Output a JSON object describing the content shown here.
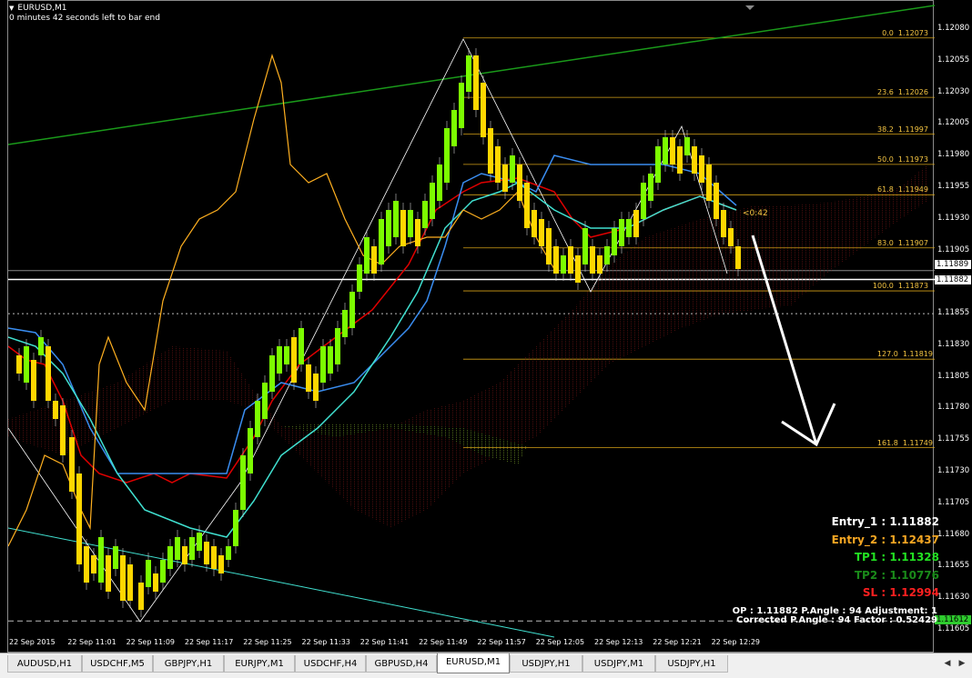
{
  "symbol": {
    "title": "EURUSD,M1",
    "countdown": "0 minutes 42 seconds left to bar end"
  },
  "price_axis": {
    "labels": [
      "1.12080",
      "1.12055",
      "1.12030",
      "1.12005",
      "1.11980",
      "1.11955",
      "1.11930",
      "1.11905",
      "1.11855",
      "1.11830",
      "1.11805",
      "1.11780",
      "1.11755",
      "1.11730",
      "1.11705",
      "1.11680",
      "1.11655",
      "1.11630",
      "1.11605"
    ],
    "bid_label": "1.11889",
    "ask_label": "1.11882",
    "level_label": "1.11612"
  },
  "time_axis": [
    "22 Sep 2015",
    "22 Sep 11:01",
    "22 Sep 11:09",
    "22 Sep 11:17",
    "22 Sep 11:25",
    "22 Sep 11:33",
    "22 Sep 11:41",
    "22 Sep 11:49",
    "22 Sep 11:57",
    "22 Sep 12:05",
    "22 Sep 12:13",
    "22 Sep 12:21",
    "22 Sep 12:29"
  ],
  "fibonacci": [
    {
      "level": "0.0",
      "price": "1.12073"
    },
    {
      "level": "23.6",
      "price": "1.12026"
    },
    {
      "level": "38.2",
      "price": "1.11997"
    },
    {
      "level": "50.0",
      "price": "1.11973"
    },
    {
      "level": "61.8",
      "price": "1.11949"
    },
    {
      "level": "83.0",
      "price": "1.11907"
    },
    {
      "level": "100.0",
      "price": "1.11873"
    },
    {
      "level": "127.0",
      "price": "1.11819"
    },
    {
      "level": "161.8",
      "price": "1.11749"
    }
  ],
  "bar_timer": "<0:42",
  "signals": {
    "entry1": "Entry_1 : 1.11882",
    "entry2": "Entry_2 : 1.12437",
    "tp1": "TP1 : 1.11328",
    "tp2": "TP2 : 1.10776",
    "sl": "SL : 1.12994"
  },
  "footer": {
    "line1": "OP : 1.11882   P.Angle : 94   Adjustment: 1",
    "line2": "Corrected P.Angle : 94   Factor : 0.52429"
  },
  "tabs": [
    "AUDUSD,H1",
    "USDCHF,M5",
    "GBPJPY,H1",
    "EURJPY,M1",
    "USDCHF,H4",
    "GBPUSD,H4",
    "EURUSD,M1",
    "USDJPY,H1",
    "USDJPY,M1",
    "USDJPY,H1"
  ],
  "active_tab": "EURUSD,M1",
  "colors": {
    "bull": "#7cfc00",
    "bear": "#ffd700",
    "red_line": "#e00000",
    "blue_line": "#3a8df0",
    "cyan_line": "#40e0d0",
    "orange_line": "#ffb020",
    "green_trend": "#1a9a1a",
    "entry1": "#ffffff",
    "entry2": "#f5a623",
    "tp1": "#22e022",
    "tp2": "#1a8a1a",
    "sl": "#ff2020"
  },
  "icons": {
    "menu": "triangle-down-icon",
    "scroll_left": "chevron-left-icon",
    "scroll_right": "chevron-right-icon"
  }
}
